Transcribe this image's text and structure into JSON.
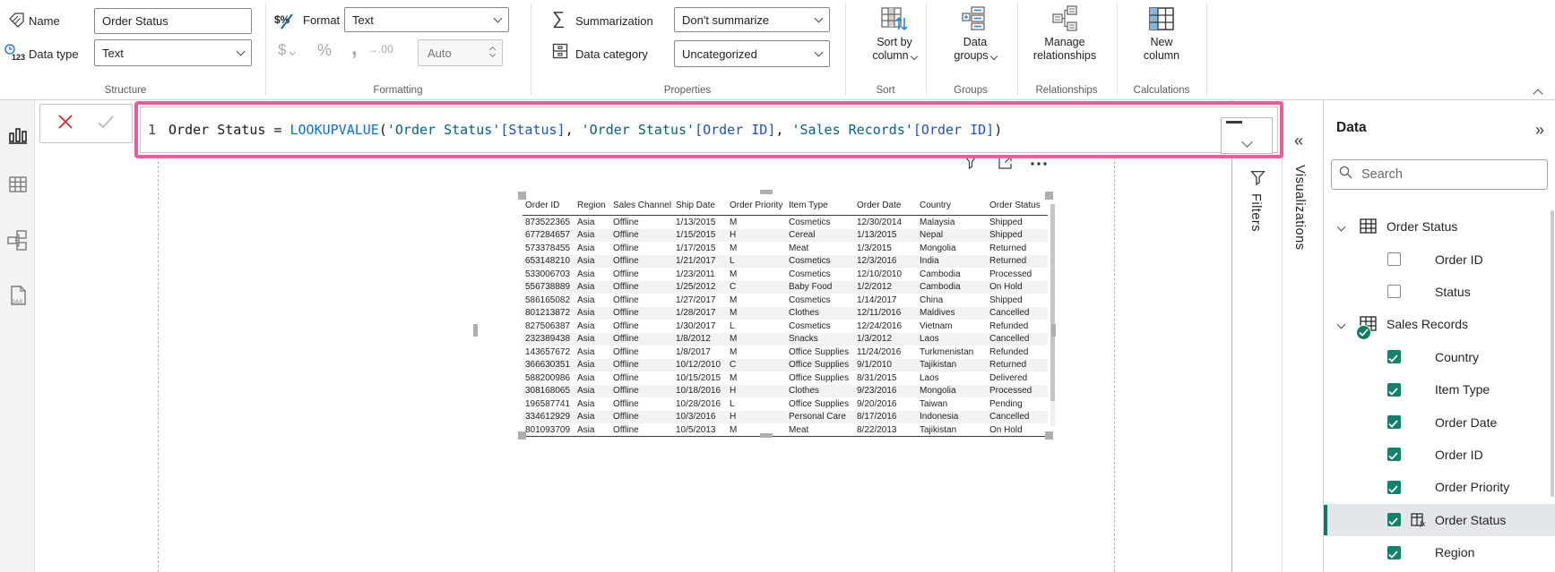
{
  "colors": {
    "highlight_pink": "#ea5c9d",
    "checkbox_teal": "#17806b",
    "selected_accent": "#0d7a68",
    "syntax": {
      "plain": "#1b1b1b",
      "function": "#0f6fd8",
      "table": "#0a617d",
      "column": "#2053b8"
    }
  },
  "ribbon": {
    "name_label": "Name",
    "name_value": "Order Status",
    "data_type_label": "Data type",
    "data_type_value": "Text",
    "format_label": "Format",
    "format_value": "Text",
    "formatting_glyphs": {
      "currency": "$",
      "percent": "%",
      "thousands": ",",
      "decimals": ".00"
    },
    "auto_placeholder": "Auto",
    "summarization_label": "Summarization",
    "summarization_value": "Don't summarize",
    "data_category_label": "Data category",
    "data_category_value": "Uncategorized",
    "buttons": [
      {
        "lines": [
          "Sort by",
          "column"
        ],
        "dropdown": true,
        "icon": "sort-by-column-icon"
      },
      {
        "lines": [
          "Data",
          "groups"
        ],
        "dropdown": true,
        "icon": "data-groups-icon"
      },
      {
        "lines": [
          "Manage",
          "relationships"
        ],
        "dropdown": false,
        "icon": "manage-relationships-icon"
      },
      {
        "lines": [
          "New",
          "column"
        ],
        "dropdown": false,
        "icon": "new-column-icon"
      }
    ],
    "groups": [
      "Structure",
      "Formatting",
      "Properties",
      "Sort",
      "Groups",
      "Relationships",
      "Calculations"
    ]
  },
  "left_rail_icons": [
    "report-view-icon",
    "table-view-icon",
    "model-view-icon",
    "dax-query-view-icon"
  ],
  "formula_bar": {
    "line_number": "1",
    "segments": [
      {
        "text": "Order Status ",
        "color": "plain"
      },
      {
        "text": "= ",
        "color": "plain"
      },
      {
        "text": "LOOKUPVALUE",
        "color": "function"
      },
      {
        "text": "(",
        "color": "plain"
      },
      {
        "text": "'Order Status'",
        "color": "table"
      },
      {
        "text": "[Status]",
        "color": "column"
      },
      {
        "text": ", ",
        "color": "plain"
      },
      {
        "text": "'Order Status'",
        "color": "table"
      },
      {
        "text": "[Order ID]",
        "color": "column"
      },
      {
        "text": ", ",
        "color": "plain"
      },
      {
        "text": "'Sales Records'",
        "color": "table"
      },
      {
        "text": "[Order ID]",
        "color": "column"
      },
      {
        "text": ")",
        "color": "plain"
      }
    ],
    "action_icons": [
      "cancel-x-icon",
      "commit-check-icon",
      "resize-dash-icon",
      "chevron-down-icon"
    ]
  },
  "table_visual": {
    "action_icons": [
      "filter-funnel-icon",
      "focus-mode-icon",
      "more-options-icon"
    ],
    "headers": [
      "Order ID",
      "Region",
      "Sales Channel",
      "Ship Date",
      "Order Priority",
      "Item Type",
      "Order Date",
      "Country",
      "Order Status"
    ],
    "rows": [
      [
        "873522365",
        "Asia",
        "Offline",
        "1/13/2015",
        "M",
        "Cosmetics",
        "12/30/2014",
        "Malaysia",
        "Shipped"
      ],
      [
        "677284657",
        "Asia",
        "Offline",
        "1/15/2015",
        "H",
        "Cereal",
        "1/13/2015",
        "Nepal",
        "Shipped"
      ],
      [
        "573378455",
        "Asia",
        "Offline",
        "1/17/2015",
        "M",
        "Meat",
        "1/3/2015",
        "Mongolia",
        "Returned"
      ],
      [
        "653148210",
        "Asia",
        "Offline",
        "1/21/2017",
        "L",
        "Cosmetics",
        "12/3/2016",
        "India",
        "Returned"
      ],
      [
        "533006703",
        "Asia",
        "Offline",
        "1/23/2011",
        "M",
        "Cosmetics",
        "12/10/2010",
        "Cambodia",
        "Processed"
      ],
      [
        "556738889",
        "Asia",
        "Offline",
        "1/25/2012",
        "C",
        "Baby Food",
        "1/2/2012",
        "Cambodia",
        "On Hold"
      ],
      [
        "586165082",
        "Asia",
        "Offline",
        "1/27/2017",
        "M",
        "Cosmetics",
        "1/14/2017",
        "China",
        "Shipped"
      ],
      [
        "801213872",
        "Asia",
        "Offline",
        "1/28/2017",
        "M",
        "Clothes",
        "12/11/2016",
        "Maldives",
        "Cancelled"
      ],
      [
        "827506387",
        "Asia",
        "Offline",
        "1/30/2017",
        "L",
        "Cosmetics",
        "12/24/2016",
        "Vietnam",
        "Refunded"
      ],
      [
        "232389438",
        "Asia",
        "Offline",
        "1/8/2012",
        "M",
        "Snacks",
        "1/3/2012",
        "Laos",
        "Cancelled"
      ],
      [
        "143657672",
        "Asia",
        "Offline",
        "1/8/2017",
        "M",
        "Office Supplies",
        "11/24/2016",
        "Turkmenistan",
        "Refunded"
      ],
      [
        "366630351",
        "Asia",
        "Offline",
        "10/12/2010",
        "C",
        "Office Supplies",
        "9/1/2010",
        "Tajikistan",
        "Returned"
      ],
      [
        "588200986",
        "Asia",
        "Offline",
        "10/15/2015",
        "M",
        "Office Supplies",
        "8/31/2015",
        "Laos",
        "Delivered"
      ],
      [
        "308168065",
        "Asia",
        "Offline",
        "10/18/2016",
        "H",
        "Clothes",
        "9/23/2016",
        "Mongolia",
        "Processed"
      ],
      [
        "196587741",
        "Asia",
        "Offline",
        "10/28/2016",
        "L",
        "Office Supplies",
        "9/20/2016",
        "Taiwan",
        "Pending"
      ],
      [
        "334612929",
        "Asia",
        "Offline",
        "10/3/2016",
        "H",
        "Personal Care",
        "8/17/2016",
        "Indonesia",
        "Cancelled"
      ],
      [
        "801093709",
        "Asia",
        "Offline",
        "10/5/2013",
        "M",
        "Meat",
        "8/22/2013",
        "Tajikistan",
        "On Hold"
      ]
    ]
  },
  "filters_pane": {
    "title": "Filters",
    "icon": "filter-funnel-icon"
  },
  "visualizations_pane": {
    "title": "Visualizations",
    "expand_icon": "chevrons-left-icon"
  },
  "data_pane": {
    "title": "Data",
    "collapse_icon": "chevrons-right-icon",
    "search_placeholder": "Search",
    "tables": [
      {
        "name": "Order Status",
        "expanded": true,
        "badge": false,
        "fields": [
          {
            "label": "Order ID",
            "checked": false,
            "selected": false
          },
          {
            "label": "Status",
            "checked": false,
            "selected": false
          }
        ]
      },
      {
        "name": "Sales Records",
        "expanded": true,
        "badge": true,
        "fields": [
          {
            "label": "Country",
            "checked": true,
            "selected": false
          },
          {
            "label": "Item Type",
            "checked": true,
            "selected": false
          },
          {
            "label": "Order Date",
            "checked": true,
            "selected": false
          },
          {
            "label": "Order ID",
            "checked": true,
            "selected": false
          },
          {
            "label": "Order Priority",
            "checked": true,
            "selected": false
          },
          {
            "label": "Order Status",
            "checked": true,
            "selected": true,
            "icon": "calculated-column-icon"
          },
          {
            "label": "Region",
            "checked": true,
            "selected": false
          }
        ]
      }
    ]
  }
}
